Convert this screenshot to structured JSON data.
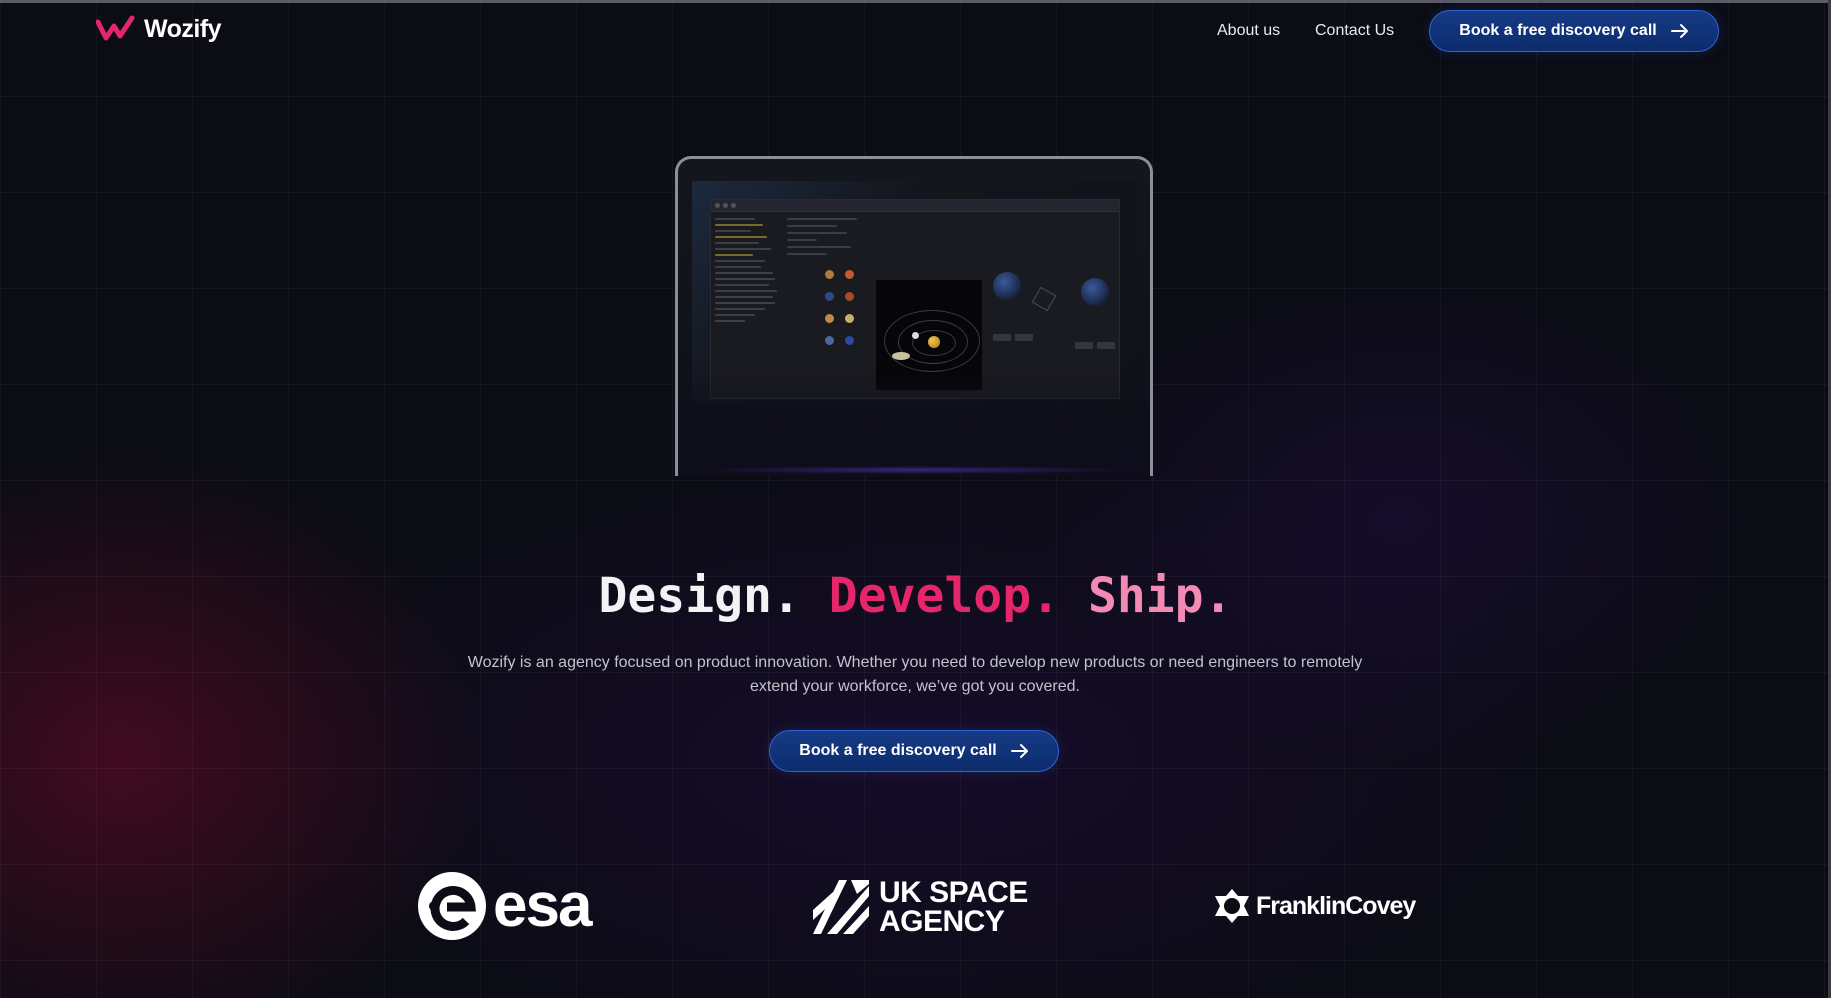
{
  "brand": {
    "name": "Wozify",
    "accent": "#e5266a"
  },
  "nav": {
    "about": "About us",
    "contact": "Contact Us",
    "cta": "Book a free discovery call"
  },
  "hero": {
    "word1": "Design.",
    "word2": "Develop.",
    "word3": "Ship.",
    "description": "Wozify is an agency focused on product innovation. Whether you need to develop new products or need engineers to remotely extend your workforce, we’ve got you covered.",
    "cta": "Book a free discovery call"
  },
  "clients": {
    "esa": "esa",
    "uk_space": {
      "line1": "UK SPACE",
      "line2": "AGENCY"
    },
    "franklin": "FranklinCovey"
  },
  "colors": {
    "button_bg": "#0c2c6c",
    "button_border": "#2e63d6",
    "develop": "#e5266a",
    "ship": "#f28ab3"
  },
  "icons": {
    "cta_arrow": "arrow-right-icon",
    "logo": "wozify-logo-icon"
  }
}
